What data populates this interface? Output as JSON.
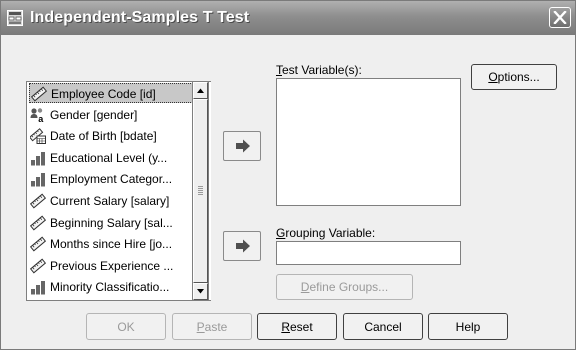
{
  "window": {
    "title": "Independent-Samples T Test",
    "app_icon": "dialog-icon",
    "close_icon": "close-icon"
  },
  "variables": [
    {
      "label": "Employee Code [id]",
      "icon": "scale-ruler-icon",
      "selected": true
    },
    {
      "label": "Gender [gender]",
      "icon": "nominal-icon",
      "selected": false
    },
    {
      "label": "Date of Birth [bdate]",
      "icon": "scale-date-icon",
      "selected": false
    },
    {
      "label": "Educational Level (y...",
      "icon": "ordinal-icon",
      "selected": false
    },
    {
      "label": "Employment Categor...",
      "icon": "ordinal-icon",
      "selected": false
    },
    {
      "label": "Current Salary [salary]",
      "icon": "scale-ruler-icon",
      "selected": false
    },
    {
      "label": "Beginning Salary [sal...",
      "icon": "scale-ruler-icon",
      "selected": false
    },
    {
      "label": "Months since Hire [jo...",
      "icon": "scale-ruler-icon",
      "selected": false
    },
    {
      "label": "Previous Experience ...",
      "icon": "scale-ruler-icon",
      "selected": false
    },
    {
      "label": "Minority Classificatio...",
      "icon": "ordinal-icon",
      "selected": false
    }
  ],
  "test_variables": {
    "label_mnemonic": "T",
    "label_rest": "est Variable(s):"
  },
  "grouping_variable": {
    "label_mnemonic": "G",
    "label_rest": "rouping Variable:",
    "value": ""
  },
  "buttons": {
    "options": {
      "mnemonic": "O",
      "rest": "ptions..."
    },
    "define_groups": {
      "mnemonic": "D",
      "rest": "efine Groups..."
    },
    "ok": "OK",
    "paste": {
      "mnemonic": "P",
      "rest": "aste"
    },
    "reset": {
      "mnemonic": "R",
      "rest": "eset"
    },
    "cancel": "Cancel",
    "help": "Help"
  },
  "colors": {
    "titlebar": "#8e8e8e",
    "selection": "#c8c8c8",
    "disabled_text": "#9a9a9a"
  }
}
